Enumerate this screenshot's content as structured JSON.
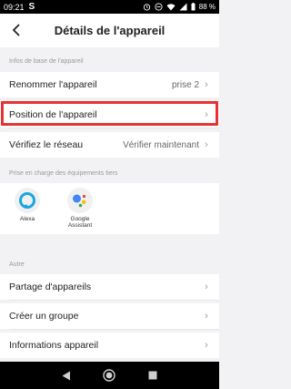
{
  "status_bar": {
    "time": "09:21",
    "carrier_icon": "S",
    "battery": "88 %"
  },
  "header": {
    "title": "Détails de l'appareil"
  },
  "sections": {
    "basic_info": "Infos de base de l'appareil",
    "third_party": "Prise en charge des équipements tiers",
    "other": "Autre"
  },
  "rows": {
    "rename": {
      "label": "Renommer l'appareil",
      "value": "prise 2"
    },
    "position": {
      "label": "Position de l'appareil"
    },
    "network": {
      "label": "Vérifiez le réseau",
      "value": "Vérifier maintenant"
    },
    "share": {
      "label": "Partage d'appareils"
    },
    "group": {
      "label": "Créer un groupe"
    },
    "info": {
      "label": "Informations appareil"
    }
  },
  "third_party_items": [
    {
      "label": "Alexa",
      "icon": "alexa-icon"
    },
    {
      "label_line1": "Google",
      "label_line2": "Assistant",
      "icon": "google-assistant-icon"
    }
  ],
  "colors": {
    "highlight": "#e53333",
    "alexa": "#1aa6e0",
    "google_blue": "#4285f4",
    "google_red": "#ea4335",
    "google_yellow": "#fbbc05",
    "google_green": "#34a853"
  },
  "nav_icons": [
    "back-triangle-icon",
    "home-circle-icon",
    "recents-square-icon"
  ]
}
